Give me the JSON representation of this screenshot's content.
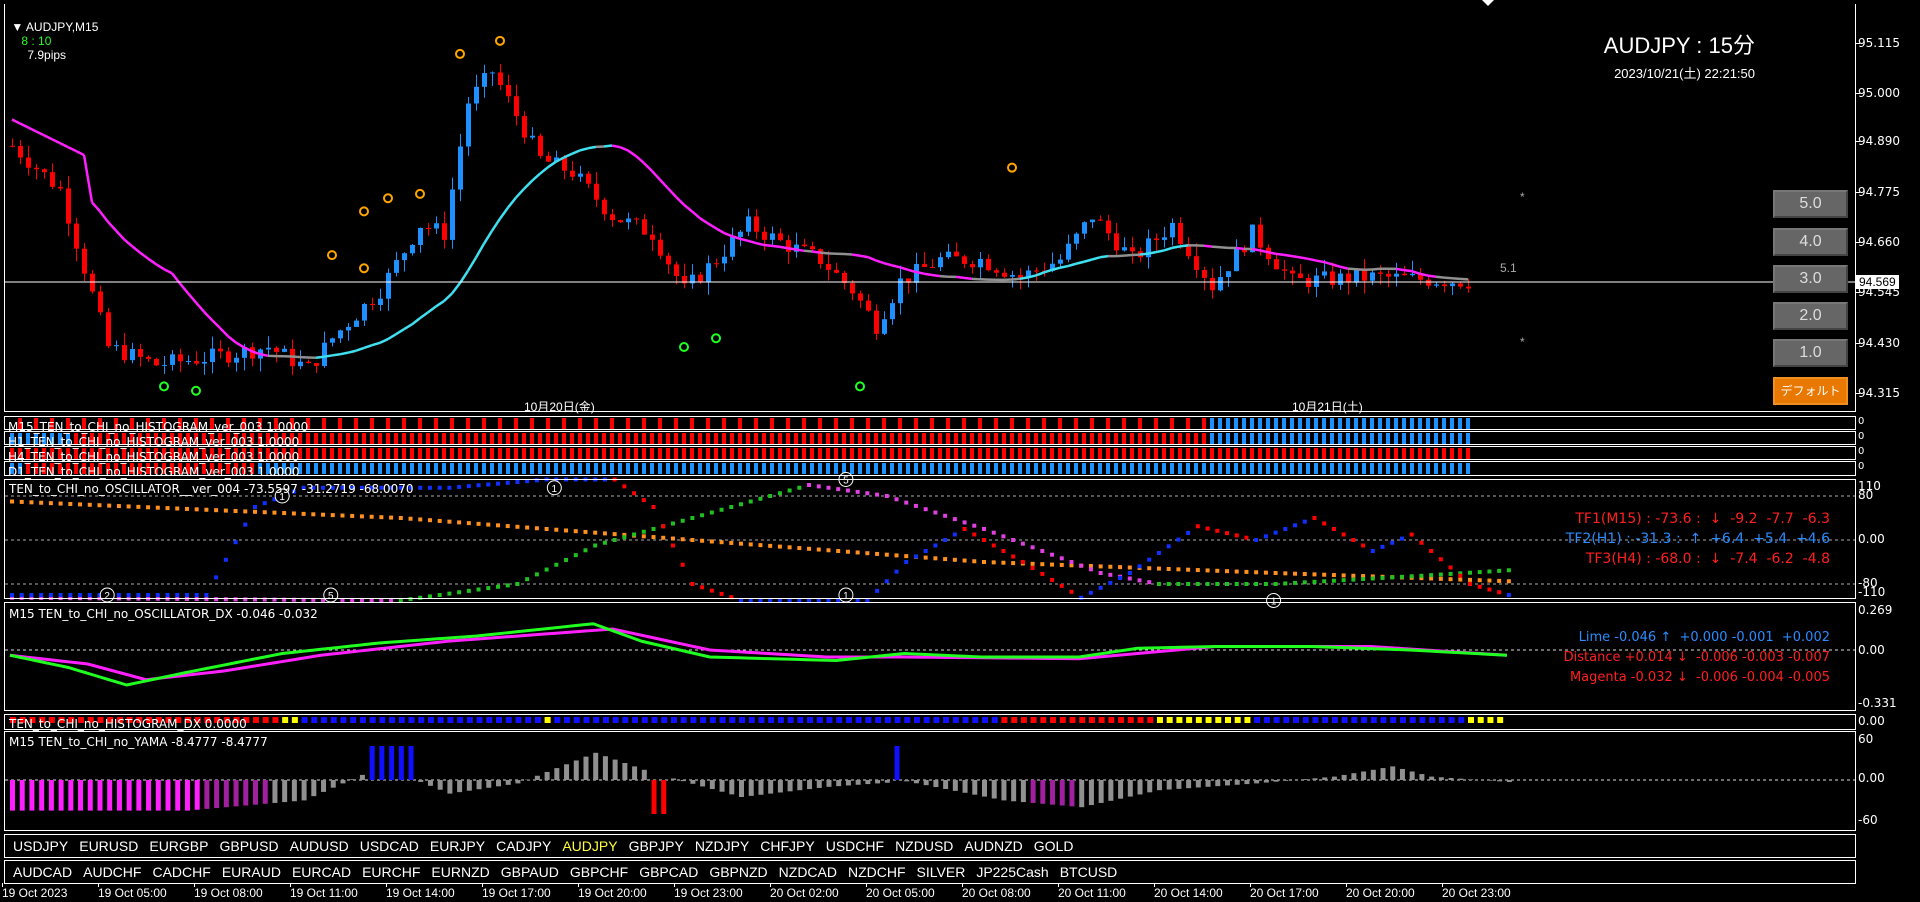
{
  "header": {
    "symbol_tf": "AUDJPY,M15",
    "countdown": "8 : 10",
    "spread": "7.9pips"
  },
  "overlay": {
    "title": "AUDJPY : 15分",
    "datetime": "2023/10/21(土) 22:21:50",
    "level_label": "5.1",
    "star": "*"
  },
  "buttons": [
    "5.0",
    "4.0",
    "3.0",
    "2.0",
    "1.0"
  ],
  "default_button": "デフォルト",
  "price_axis": {
    "ticks": [
      "95.115",
      "95.000",
      "94.890",
      "94.775",
      "94.660",
      "94.545",
      "94.430",
      "94.315"
    ],
    "current": "94.569"
  },
  "day_labels": [
    "10月20日(金)",
    "10月21日(土)"
  ],
  "histograms": [
    {
      "title": "M15_TEN_to_CHI_no_HISTOGRAM_ver_003 1.0000",
      "axis": "0"
    },
    {
      "title": "H1_TEN_to_CHI_no_HISTOGRAM_ver_003 1.0000",
      "axis": "0"
    },
    {
      "title": "H4_TEN_to_CHI_no_HISTOGRAM_ver_003 1.0000",
      "axis": "0"
    },
    {
      "title": "D1_TEN_to_CHI_no_HISTOGRAM_ver_003 1.0000",
      "axis": "0"
    }
  ],
  "oscillator": {
    "title": "TEN_to_CHI_no_OSCILLATOR__ver_004 -73.5597 -31.2719 -68.0070",
    "axis": [
      "110",
      "80",
      "0.00",
      "-80",
      "-110"
    ],
    "rows": [
      {
        "text": "TF1(M15) : -73.6 :  ↓  -9.2  -7.7  -6.3",
        "color": "#ff2020"
      },
      {
        "text": "TF2(H1) : -31.3 :  ↑  +6.4  +5.4  +4.6",
        "color": "#2a8cff"
      },
      {
        "text": "TF3(H4) : -68.0 :  ↓  -7.4  -6.2  -4.8",
        "color": "#ff2020"
      }
    ],
    "markers": [
      "1",
      "2",
      "5",
      "1",
      "5",
      "1",
      "1"
    ]
  },
  "dx": {
    "title": "M15 TEN_to_CHI_no_OSCILLATOR_DX  -0.046 -0.032",
    "axis": [
      "0.269",
      "0.00",
      "-0.331"
    ],
    "rows": [
      {
        "text": "Lime -0.046 ↑  +0.000 -0.001  +0.002",
        "color": "#2a8cff"
      },
      {
        "text": "Distance +0.014 ↓  -0.006 -0.003 -0.007",
        "color": "#ff2020"
      },
      {
        "text": "Magenta -0.032 ↓  -0.006 -0.004 -0.005",
        "color": "#ff2020"
      }
    ]
  },
  "hist_dx": {
    "title": "TEN_to_CHI_no_HISTOGRAM_DX 0.0000",
    "axis": "0.00"
  },
  "yama": {
    "title": "M15  TEN_to_CHI_no_YAMA  -8.4777 -8.4777",
    "axis": [
      "60",
      "0.00",
      "-60"
    ]
  },
  "symbols_row1": [
    "USDJPY",
    "EURUSD",
    "EURGBP",
    "GBPUSD",
    "AUDUSD",
    "USDCAD",
    "EURJPY",
    "CADJPY",
    "AUDJPY",
    "GBPJPY",
    "NZDJPY",
    "CHFJPY",
    "USDCHF",
    "NZDUSD",
    "AUDNZD",
    "GOLD"
  ],
  "symbols_row2": [
    "AUDCAD",
    "AUDCHF",
    "CADCHF",
    "EURAUD",
    "EURCAD",
    "EURCHF",
    "EURNZD",
    "GBPAUD",
    "GBPCHF",
    "GBPCAD",
    "GBPNZD",
    "NZDCAD",
    "NZDCHF",
    "SILVER",
    "JP225Cash",
    "BTCUSD"
  ],
  "active_symbol": "AUDJPY",
  "time_axis": [
    "19 Oct 2023",
    "19 Oct 05:00",
    "19 Oct 08:00",
    "19 Oct 11:00",
    "19 Oct 14:00",
    "19 Oct 17:00",
    "19 Oct 20:00",
    "19 Oct 23:00",
    "20 Oct 02:00",
    "20 Oct 05:00",
    "20 Oct 08:00",
    "20 Oct 11:00",
    "20 Oct 14:00",
    "20 Oct 17:00",
    "20 Oct 20:00",
    "20 Oct 23:00"
  ],
  "colors": {
    "bull": "#1e90ff",
    "bear": "#ff0000",
    "rising": "#40e0f0",
    "falling": "#ff20ff",
    "flat": "#909090",
    "active": "#ffff40",
    "button": "#e87800"
  },
  "chart_data": {
    "type": "candlestick",
    "bars": 183,
    "ylim": [
      94.28,
      95.17
    ],
    "price_path": [
      [
        0,
        94.88
      ],
      [
        6,
        94.78
      ],
      [
        12,
        94.42
      ],
      [
        18,
        94.38
      ],
      [
        26,
        94.4
      ],
      [
        32,
        94.42
      ],
      [
        37,
        94.37
      ],
      [
        40,
        94.44
      ],
      [
        46,
        94.55
      ],
      [
        51,
        94.7
      ],
      [
        54,
        94.68
      ],
      [
        57,
        94.98
      ],
      [
        60,
        95.05
      ],
      [
        63,
        94.95
      ],
      [
        66,
        94.85
      ],
      [
        70,
        94.82
      ],
      [
        75,
        94.72
      ],
      [
        80,
        94.68
      ],
      [
        84,
        94.55
      ],
      [
        88,
        94.62
      ],
      [
        92,
        94.7
      ],
      [
        96,
        94.66
      ],
      [
        101,
        94.62
      ],
      [
        105,
        94.55
      ],
      [
        108,
        94.47
      ],
      [
        111,
        94.57
      ],
      [
        116,
        94.62
      ],
      [
        121,
        94.62
      ],
      [
        126,
        94.58
      ],
      [
        131,
        94.62
      ],
      [
        135,
        94.72
      ],
      [
        140,
        94.62
      ],
      [
        145,
        94.7
      ],
      [
        150,
        94.56
      ],
      [
        155,
        94.68
      ],
      [
        160,
        94.57
      ],
      [
        170,
        94.58
      ],
      [
        182,
        94.57
      ]
    ],
    "oscillator_tf1": [
      [
        0,
        -100
      ],
      [
        20,
        -100
      ],
      [
        25,
        60
      ],
      [
        30,
        95
      ],
      [
        45,
        95
      ],
      [
        55,
        110
      ],
      [
        62,
        110
      ],
      [
        66,
        60
      ],
      [
        70,
        -80
      ],
      [
        75,
        -110
      ],
      [
        88,
        -110
      ],
      [
        92,
        -40
      ],
      [
        98,
        20
      ],
      [
        104,
        -40
      ],
      [
        110,
        -105
      ],
      [
        115,
        -60
      ],
      [
        122,
        25
      ],
      [
        128,
        0
      ],
      [
        134,
        40
      ],
      [
        140,
        -20
      ],
      [
        144,
        10
      ],
      [
        150,
        -80
      ],
      [
        154,
        -100
      ]
    ],
    "oscillator_tf2": [
      [
        0,
        -105
      ],
      [
        40,
        -110
      ],
      [
        52,
        -80
      ],
      [
        60,
        -10
      ],
      [
        70,
        40
      ],
      [
        82,
        100
      ],
      [
        90,
        80
      ],
      [
        100,
        20
      ],
      [
        112,
        -60
      ],
      [
        118,
        -80
      ],
      [
        130,
        -80
      ],
      [
        145,
        -65
      ],
      [
        154,
        -55
      ]
    ],
    "oscillator_tf3": [
      [
        0,
        70
      ],
      [
        40,
        40
      ],
      [
        70,
        0
      ],
      [
        100,
        -40
      ],
      [
        130,
        -60
      ],
      [
        154,
        -75
      ]
    ],
    "dx_lime": [
      [
        0,
        -0.03
      ],
      [
        6,
        -0.1
      ],
      [
        12,
        -0.2
      ],
      [
        18,
        -0.13
      ],
      [
        28,
        -0.02
      ],
      [
        38,
        0.04
      ],
      [
        48,
        0.08
      ],
      [
        60,
        0.15
      ],
      [
        65,
        0.05
      ],
      [
        72,
        -0.04
      ],
      [
        85,
        -0.06
      ],
      [
        92,
        -0.02
      ],
      [
        100,
        -0.04
      ],
      [
        110,
        -0.04
      ],
      [
        116,
        0.01
      ],
      [
        124,
        0.02
      ],
      [
        134,
        0.02
      ],
      [
        144,
        0.0
      ],
      [
        154,
        -0.03
      ]
    ],
    "dx_magenta": [
      [
        0,
        -0.03
      ],
      [
        8,
        -0.08
      ],
      [
        14,
        -0.17
      ],
      [
        22,
        -0.12
      ],
      [
        32,
        -0.03
      ],
      [
        45,
        0.05
      ],
      [
        62,
        0.12
      ],
      [
        72,
        0.0
      ],
      [
        84,
        -0.04
      ],
      [
        92,
        -0.04
      ],
      [
        110,
        -0.05
      ],
      [
        124,
        0.02
      ],
      [
        140,
        0.02
      ],
      [
        154,
        -0.03
      ]
    ],
    "yama": [
      [
        0,
        -45
      ],
      [
        18,
        -45
      ],
      [
        30,
        -30
      ],
      [
        38,
        20
      ],
      [
        45,
        -20
      ],
      [
        52,
        -5
      ],
      [
        60,
        40
      ],
      [
        66,
        10
      ],
      [
        75,
        -25
      ],
      [
        84,
        -10
      ],
      [
        92,
        -2
      ],
      [
        102,
        -30
      ],
      [
        110,
        -40
      ],
      [
        118,
        -15
      ],
      [
        128,
        -5
      ],
      [
        136,
        5
      ],
      [
        142,
        20
      ],
      [
        146,
        5
      ],
      [
        154,
        -3
      ]
    ]
  }
}
